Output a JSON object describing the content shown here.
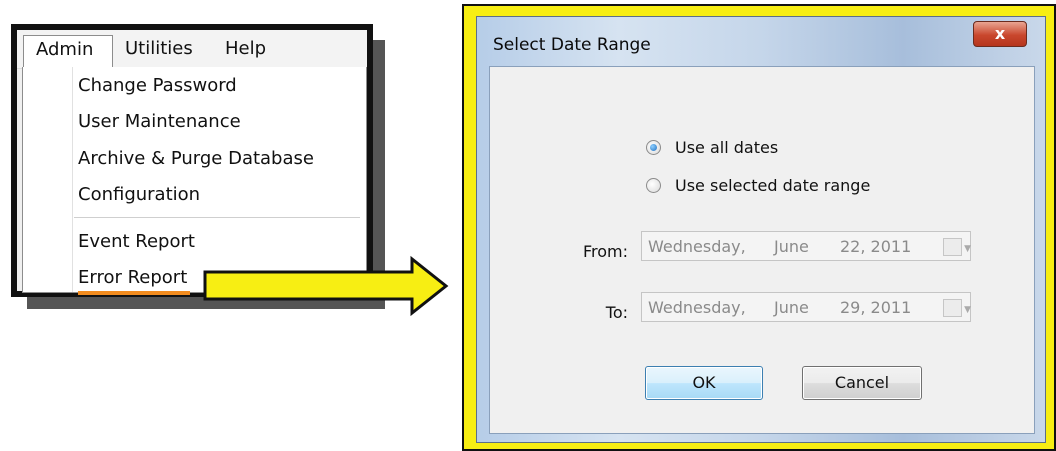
{
  "menu": {
    "bar": [
      "Admin",
      "Utilities",
      "Help"
    ],
    "items": [
      "Change Password",
      "User Maintenance",
      "Archive & Purge Database",
      "Configuration"
    ],
    "reports": [
      "Event Report",
      "Error Report"
    ],
    "highlight_color": "#f28c1f"
  },
  "arrow": {
    "fill": "#f7ee13",
    "icon": "right-arrow-icon"
  },
  "dialog": {
    "title": "Select Date Range",
    "close_glyph": "x",
    "options": {
      "all_dates": "Use all dates",
      "selected_range": "Use selected date range",
      "selected": "all_dates"
    },
    "from": {
      "label": "From:",
      "weekday": "Wednesday,",
      "month": "June",
      "day_year": "22, 2011"
    },
    "to": {
      "label": "To:",
      "weekday": "Wednesday,",
      "month": "June",
      "day_year": "29, 2011"
    },
    "buttons": {
      "ok": "OK",
      "cancel": "Cancel"
    },
    "frame_color": "#f7ee13"
  }
}
